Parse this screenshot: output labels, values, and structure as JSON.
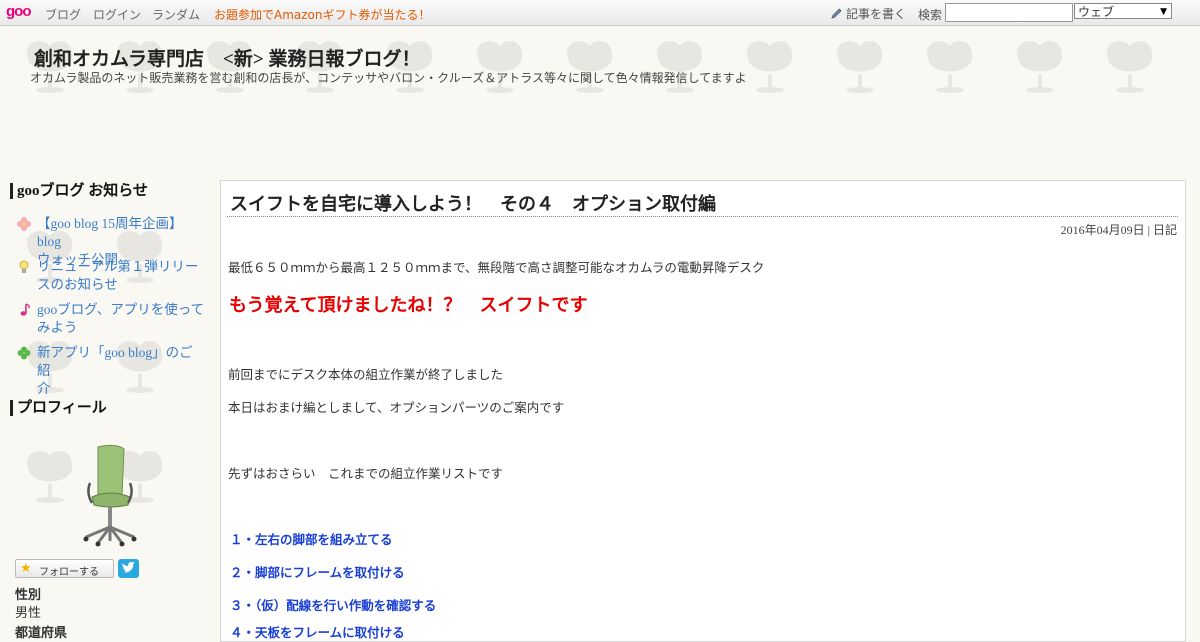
{
  "topbar": {
    "logo": "goo",
    "nav": [
      "ブログ",
      "ログイン",
      "ランダム"
    ],
    "promo": "お題参加でAmazonギフト券が当たる！",
    "write_label": "記事を書く",
    "search_label": "検索",
    "search_value": "",
    "search_scope": "ウェブ"
  },
  "header": {
    "title": "創和オカムラ専門店　<新> 業務日報ブログ！",
    "description": "オカムラ製品のネット販売業務を営む創和の店長が、コンテッサやバロン・クルーズ＆アトラス等々に関して色々情報発信してますよ"
  },
  "sidebar": {
    "news_heading": "gooブログ お知らせ",
    "news": [
      {
        "icon": "flower-icon",
        "lines": [
          "【goo blog 15周年企画】blog",
          "ウォッチ公開"
        ]
      },
      {
        "icon": "bulb-icon",
        "lines": [
          "リニューアル第１弾リリー",
          "スのお知らせ"
        ]
      },
      {
        "icon": "music-note-icon",
        "lines": [
          "gooブログ、アプリを使って",
          "みよう"
        ]
      },
      {
        "icon": "clover-icon",
        "lines": [
          "新アプリ「goo blog」のご紹",
          "介"
        ]
      }
    ],
    "profile_heading": "プロフィール",
    "follow_label": "フォローする",
    "gender_label": "性別",
    "gender_value": "男性",
    "region_label": "都道府県"
  },
  "post": {
    "title": "スイフトを自宅に導入しよう！　その４　オプション取付編",
    "date": "2016年04月09日",
    "separator": "|",
    "category": "日記",
    "paragraphs": [
      "最低６５０ｍｍから最高１２５０ｍｍまで、無段階で高さ調整可能なオカムラの電動昇降デスク",
      "前回までにデスク本体の組立作業が終了しました",
      "本日はおまけ編としまして、オプションパーツのご案内です",
      "先ずはおさらい　これまでの組立作業リストです"
    ],
    "highlight": "もう覚えて頂けましたね！？　スイフトです",
    "steps": [
      "１・左右の脚部を組み立てる",
      "２・脚部にフレームを取付ける",
      "３・（仮）配線を行い作動を確認する",
      "４・天板をフレームに取付ける"
    ]
  },
  "colors": {
    "accent_red": "#e60000",
    "link_blue": "#3a7cc9",
    "step_blue": "#1a3fd6",
    "promo_orange": "#e05a00"
  }
}
